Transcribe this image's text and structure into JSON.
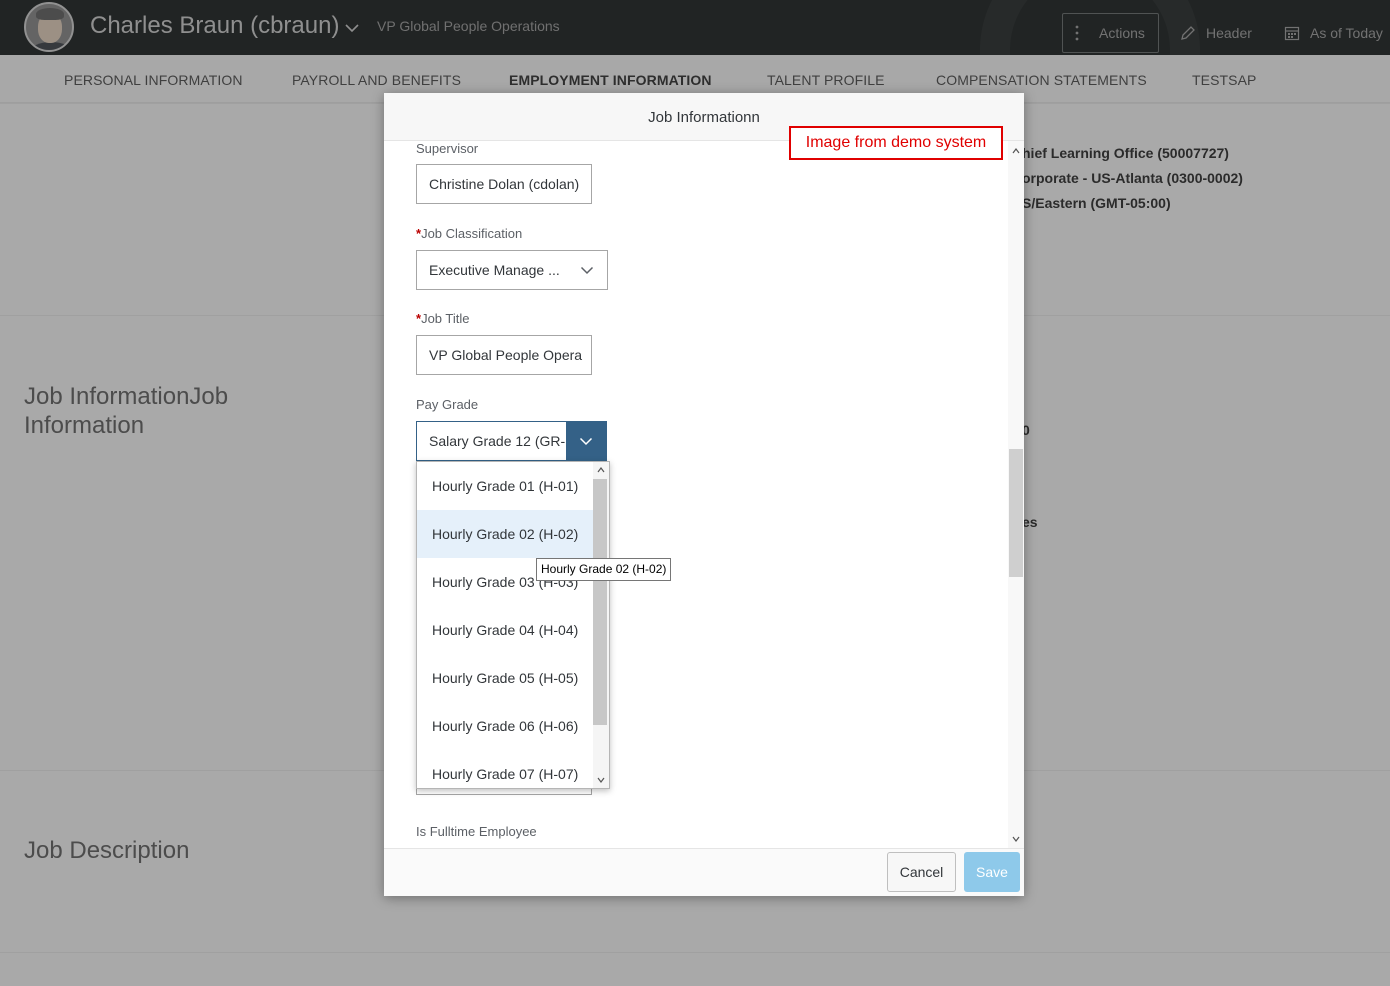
{
  "header": {
    "employee_name": "Charles Braun (cbraun)",
    "employee_title": "VP Global People Operations",
    "actions_label": "Actions",
    "header_label": "Header",
    "as_of_label": "As of Today"
  },
  "tabs": [
    {
      "label": "PERSONAL INFORMATION"
    },
    {
      "label": "PAYROLL AND BENEFITS"
    },
    {
      "label": "EMPLOYMENT INFORMATION",
      "active": true
    },
    {
      "label": "TALENT PROFILE"
    },
    {
      "label": "COMPENSATION STATEMENTS"
    },
    {
      "label": "TESTSAP"
    }
  ],
  "background": {
    "job_info_title": "Job InformationJob Information",
    "job_desc_title": "Job Description",
    "values": [
      "hief Learning Office (50007727)",
      "orporate - US-Atlanta (0300-0002)",
      "S/Eastern (GMT-05:00)",
      "0",
      "es"
    ]
  },
  "dialog": {
    "title": "Job Informationn",
    "fields": {
      "supervisor": {
        "label": "Supervisor",
        "value": "Christine Dolan (cdolan)"
      },
      "job_classification": {
        "label": "Job Classification",
        "value": "Executive Manage ..."
      },
      "job_title": {
        "label": "Job Title",
        "value": "VP Global People Opera"
      },
      "pay_grade": {
        "label": "Pay Grade",
        "value": "Salary Grade 12 (GR-"
      },
      "is_fulltime": {
        "label": "Is Fulltime Employee"
      }
    },
    "required_marker": "*",
    "pay_grade_options": [
      "Hourly Grade 01 (H-01)",
      "Hourly Grade 02 (H-02)",
      "Hourly Grade 03 (H-03)",
      "Hourly Grade 04 (H-04)",
      "Hourly Grade 05 (H-05)",
      "Hourly Grade 06 (H-06)",
      "Hourly Grade 07 (H-07)"
    ],
    "highlighted_option": "Hourly Grade 02 (H-02)",
    "tooltip": "Hourly Grade 02 (H-02)",
    "cancel_label": "Cancel",
    "save_label": "Save"
  },
  "annotation": "Image from demo system",
  "colors": {
    "header_bg": "#2f3333",
    "accent": "#346187",
    "save_button": "#8ec9ea",
    "required": "#bb0000",
    "annotation_red": "#e00000"
  }
}
